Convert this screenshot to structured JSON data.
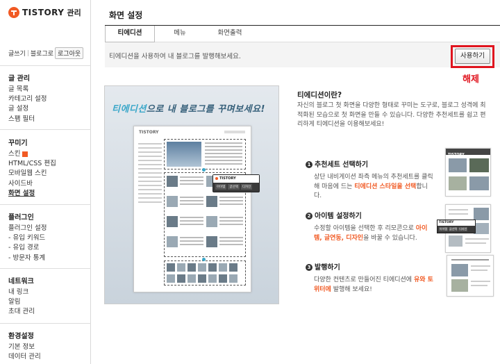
{
  "sidebar": {
    "logo": "TISTORY",
    "logo_sub": "관리",
    "account": {
      "write": "글쓰기",
      "blog": "블로그로",
      "logout": "로그아웃"
    },
    "groups": [
      {
        "title": "글 관리",
        "items": [
          "글 목록",
          "카테고리 설정",
          "글 설정",
          "스팸 필터"
        ]
      },
      {
        "title": "꾸미기",
        "items": [
          "스킨",
          "HTML/CSS 편집",
          "모바일웹 스킨",
          "사이드바",
          "화면 설정"
        ],
        "active_index": 4,
        "badge_index": 0
      },
      {
        "title": "플러그인",
        "items": [
          "플러그인 설정",
          "- 유입 키워드",
          "- 유입 경로",
          "- 방문자 통계"
        ]
      },
      {
        "title": "네트워크",
        "items": [
          "내 링크",
          "알림",
          "초대 관리"
        ]
      },
      {
        "title": "환경설정",
        "items": [
          "기본 정보",
          "데이터 관리"
        ]
      }
    ]
  },
  "main": {
    "title": "화면 설정",
    "tabs": [
      {
        "label": "티에디션",
        "active": true
      },
      {
        "label": "메뉴",
        "active": false
      },
      {
        "label": "화면출력",
        "active": false
      }
    ],
    "info_text": "티에디션을 사용하여 내 블로그를 발행해보세요.",
    "use_button": "사용하기",
    "cancel_label": "해제",
    "highlight_color": "#e0141e"
  },
  "preview": {
    "headline_a": "티에디션",
    "headline_b": "으로 내 블로그를 꾸며보세요!",
    "paper_logo": "TISTORY",
    "popup_logo": "TISTORY",
    "popup_tabs": [
      "아이템",
      "글선택",
      "디자인"
    ]
  },
  "about": {
    "title": "티에디션이란?",
    "desc": "자신의 블로그 첫 화면을 다양한 형태로 꾸미는 도구로, 블로그 성격에 최적화된 모습으로 첫 화면을 만들 수 있습니다. 다양한 추천세트를 쉽고 편리하게 티에디션을 이용해보세요!"
  },
  "steps": [
    {
      "num": "1",
      "title": "추천세트 선택하기",
      "desc_a": "상단 내비게이션 좌측 메뉴의 추천세트를 클릭해 마음에 드는 ",
      "desc_hl": "티에디션 스타일을 선택",
      "desc_b": "합니다."
    },
    {
      "num": "2",
      "title": "아이템 설정하기",
      "desc_a": "수정할 아이템을 선택한 후 리모콘으로 ",
      "desc_hl": "아이템, 글연동, 디자인",
      "desc_b": "을 바꿀 수 있습니다."
    },
    {
      "num": "3",
      "title": "발행하기",
      "desc_a": "다양한 컨텐츠로 만들어진 티에디션에 ",
      "desc_hl": "유와 토위터에",
      "desc_b": " 발행해 보세요!"
    }
  ],
  "thumbs": {
    "logo": "TISTORY",
    "pop_tabs": [
      "아이템",
      "글선택",
      "디자인"
    ]
  },
  "icons": {
    "logo": "tistory-logo-icon",
    "badge": "new-badge-icon"
  },
  "colors": {
    "accent": "#f15a24",
    "headline_blue": "#3aa7c9"
  }
}
